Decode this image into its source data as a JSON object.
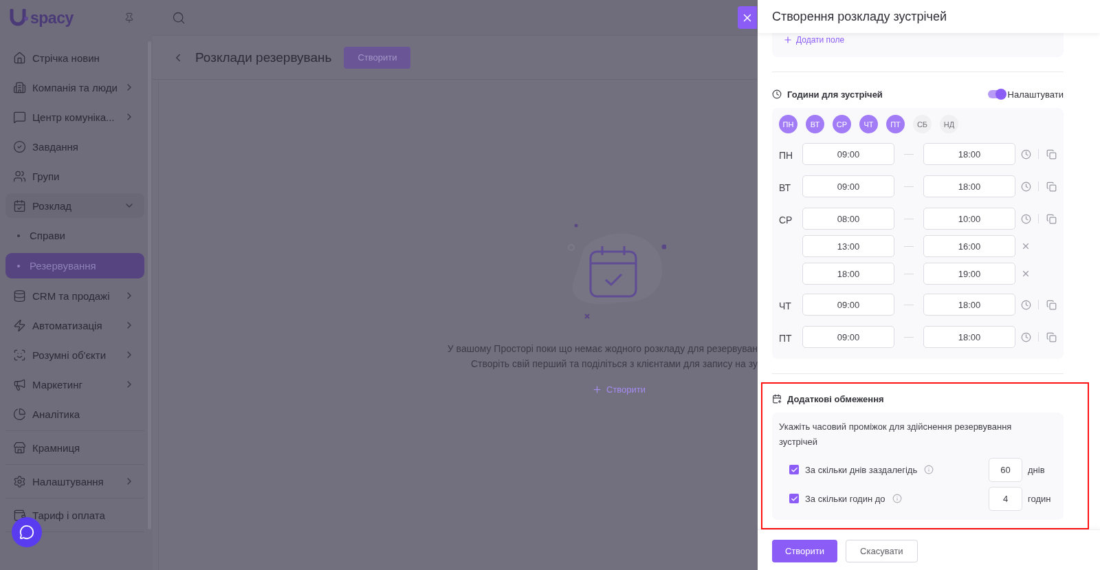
{
  "sidebar": {
    "logo": "spacy",
    "sections": [
      [
        {
          "label": "Стрічка новин",
          "kind": "link"
        },
        {
          "label": "Компанія та люди",
          "kind": "group",
          "expanded": false
        },
        {
          "label": "Центр комуніка...",
          "kind": "group",
          "expanded": false
        },
        {
          "label": "Завдання",
          "kind": "link"
        },
        {
          "label": "Групи",
          "kind": "link"
        },
        {
          "label": "Розклад",
          "kind": "group",
          "expanded": true,
          "children": [
            {
              "label": "Справи",
              "selected": false
            },
            {
              "label": "Резервування",
              "selected": true
            }
          ]
        },
        {
          "label": "CRM та продажі",
          "kind": "group",
          "expanded": false
        },
        {
          "label": "Автоматизація",
          "kind": "group",
          "expanded": false
        },
        {
          "label": "Розумні об'єкти",
          "kind": "group",
          "expanded": false
        },
        {
          "label": "Маркетинг",
          "kind": "group",
          "expanded": false
        },
        {
          "label": "Аналітика",
          "kind": "link"
        }
      ],
      [
        {
          "label": "Крамниця",
          "kind": "link"
        }
      ],
      [
        {
          "label": "Налаштування",
          "kind": "group",
          "expanded": false
        }
      ],
      [
        {
          "label": "Тариф і оплата",
          "kind": "link"
        }
      ]
    ]
  },
  "page": {
    "title": "Розклади резервувань",
    "create_button": "Створити",
    "empty_state": {
      "lines": [
        "У вашому Просторі поки що немає жодного розкладу для резервуван",
        "Створіть свій перший та поділіться з клієнтами для запису на зу"
      ],
      "action": "Створити"
    }
  },
  "drawer": {
    "title": "Створення розкладу зустрічей",
    "add_field": "Додати поле",
    "hours": {
      "title": "Години для зустрічей",
      "toggle": {
        "label": "Налаштувати",
        "on": true
      },
      "days": [
        {
          "label": "ПН",
          "selected": true
        },
        {
          "label": "ВТ",
          "selected": true
        },
        {
          "label": "СР",
          "selected": true
        },
        {
          "label": "ЧТ",
          "selected": true
        },
        {
          "label": "ПТ",
          "selected": true
        },
        {
          "label": "СБ",
          "selected": false
        },
        {
          "label": "НД",
          "selected": false
        }
      ],
      "schedule": [
        {
          "day": "ПН",
          "slots": [
            {
              "from": "09:00",
              "to": "18:00"
            }
          ]
        },
        {
          "day": "ВТ",
          "slots": [
            {
              "from": "09:00",
              "to": "18:00"
            }
          ]
        },
        {
          "day": "СР",
          "slots": [
            {
              "from": "08:00",
              "to": "10:00"
            },
            {
              "from": "13:00",
              "to": "16:00"
            },
            {
              "from": "18:00",
              "to": "19:00"
            }
          ]
        },
        {
          "day": "ЧТ",
          "slots": [
            {
              "from": "09:00",
              "to": "18:00"
            }
          ]
        },
        {
          "day": "ПТ",
          "slots": [
            {
              "from": "09:00",
              "to": "18:00"
            }
          ]
        }
      ]
    },
    "restrictions": {
      "title": "Додаткові обмеження",
      "description": "Укажіть часовий проміжок для здійснення резервування зустрічей",
      "rules": [
        {
          "label": "За скільки днів заздалегідь",
          "checked": true,
          "value": "60",
          "unit": "днів"
        },
        {
          "label": "За скільки годин до",
          "checked": true,
          "value": "4",
          "unit": "годин"
        }
      ]
    },
    "buttons": {
      "primary": "Створити",
      "secondary": "Скасувати"
    }
  }
}
